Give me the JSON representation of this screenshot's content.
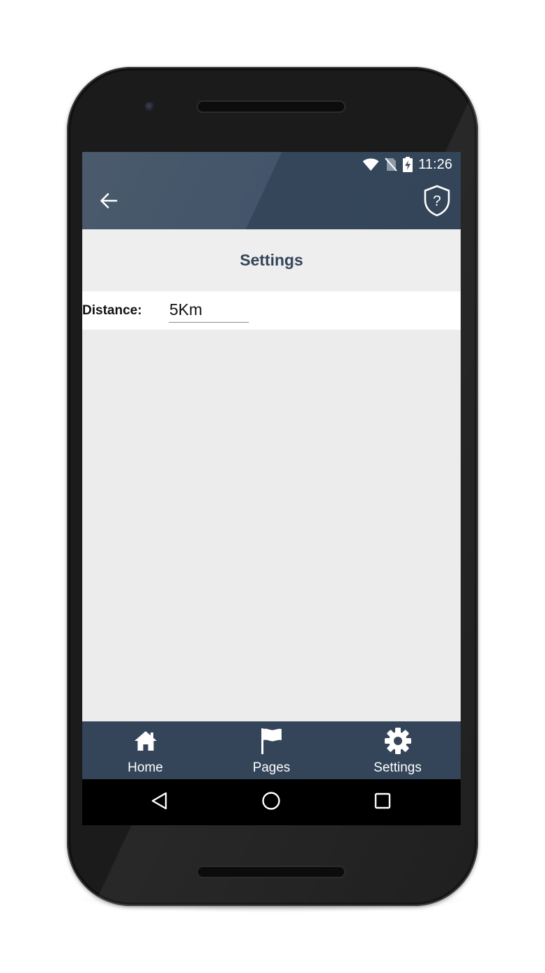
{
  "status_bar": {
    "time": "11:26",
    "icons": [
      "wifi-icon",
      "no-sim-icon",
      "battery-charging-icon"
    ]
  },
  "app_bar": {
    "back_icon": "arrow-left-icon",
    "help_icon": "shield-question-icon"
  },
  "page": {
    "title": "Settings"
  },
  "settings": {
    "distance_label": "Distance:",
    "distance_value": "5Km"
  },
  "bottom_nav": {
    "items": [
      {
        "label": "Home",
        "icon": "home-icon"
      },
      {
        "label": "Pages",
        "icon": "flag-icon"
      },
      {
        "label": "Settings",
        "icon": "gear-icon"
      }
    ]
  },
  "system_nav": {
    "icons": [
      "back-triangle-icon",
      "home-circle-icon",
      "recents-square-icon"
    ]
  },
  "colors": {
    "primary": "#34455a",
    "background": "#ececec",
    "surface": "#ffffff",
    "title_text": "#34455a"
  }
}
